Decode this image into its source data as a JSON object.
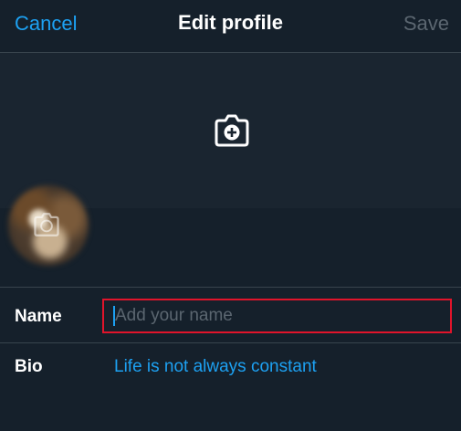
{
  "nav": {
    "cancel_label": "Cancel",
    "title": "Edit profile",
    "save_label": "Save"
  },
  "header": {
    "icon": "camera-plus-icon"
  },
  "avatar": {
    "icon": "camera-plus-icon"
  },
  "form": {
    "name": {
      "label": "Name",
      "value": "",
      "placeholder": "Add your name"
    },
    "bio": {
      "label": "Bio",
      "value": "Life is not always constant"
    }
  },
  "colors": {
    "background": "#15202b",
    "header_background": "#1a2530",
    "accent": "#1da1f2",
    "disabled_text": "#5b6670",
    "divider": "#38444d",
    "highlight_border": "#e0142b"
  }
}
